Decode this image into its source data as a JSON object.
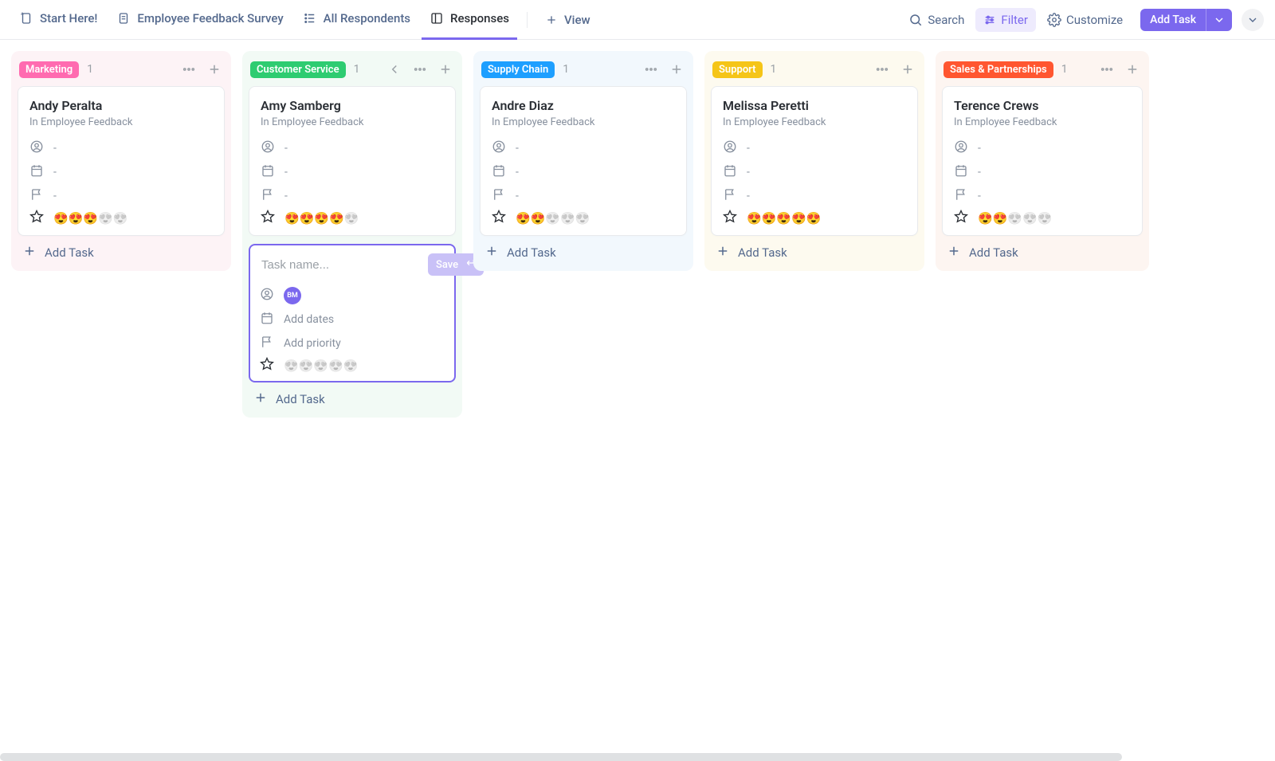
{
  "toolbar": {
    "start_here": "Start Here!",
    "survey": "Employee Feedback Survey",
    "all_respondents": "All Respondents",
    "responses": "Responses",
    "view": "View",
    "search": "Search",
    "filter": "Filter",
    "customize": "Customize",
    "add_task": "Add Task"
  },
  "composer": {
    "placeholder": "Task name...",
    "save": "Save",
    "add_dates": "Add dates",
    "add_priority": "Add priority",
    "avatar_initials": "BM"
  },
  "common": {
    "add_task": "Add Task",
    "subtext": "In Employee Feedback",
    "empty_value": "-"
  },
  "columns": [
    {
      "label": "Marketing",
      "color": "#ff6bb0",
      "tint": "tint-pink",
      "count": "1",
      "active": false,
      "card": {
        "name": "Andy Peralta",
        "rating_on": 3,
        "rating_off": 2
      }
    },
    {
      "label": "Customer Service",
      "color": "#2ecc71",
      "tint": "tint-green",
      "count": "1",
      "active": true,
      "card": {
        "name": "Amy Samberg",
        "rating_on": 4,
        "rating_off": 1
      }
    },
    {
      "label": "Supply Chain",
      "color": "#1e9fff",
      "tint": "tint-blue",
      "count": "1",
      "active": false,
      "card": {
        "name": "Andre Diaz",
        "rating_on": 2,
        "rating_off": 3
      }
    },
    {
      "label": "Support",
      "color": "#f5c518",
      "tint": "tint-yellow",
      "count": "1",
      "active": false,
      "card": {
        "name": "Melissa Peretti",
        "rating_on": 5,
        "rating_off": 0
      }
    },
    {
      "label": "Sales & Partnerships",
      "color": "#ff5630",
      "tint": "tint-orange",
      "count": "1",
      "active": false,
      "edge": true,
      "card": {
        "name": "Terence Crews",
        "rating_on": 2,
        "rating_off": 3
      }
    }
  ]
}
